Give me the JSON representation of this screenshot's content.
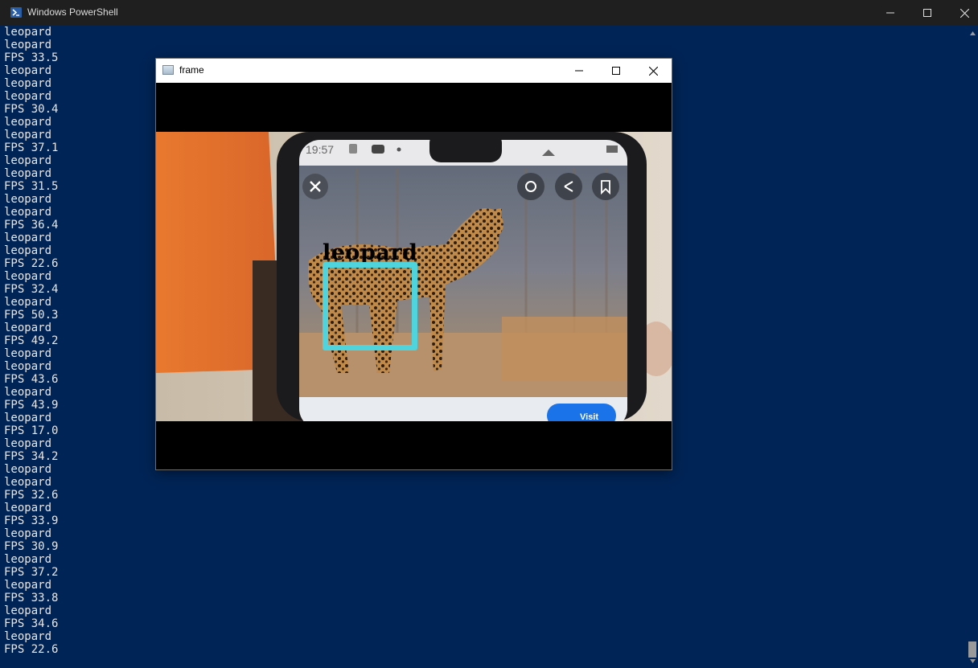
{
  "window": {
    "title": "Windows PowerShell",
    "icon": "powershell-icon",
    "controls": [
      "minimize-icon",
      "maximize-icon",
      "close-icon"
    ]
  },
  "console": {
    "lines": [
      "leopard",
      "leopard",
      "FPS 33.5",
      "leopard",
      "leopard",
      "leopard",
      "FPS 30.4",
      "leopard",
      "leopard",
      "FPS 37.1",
      "leopard",
      "leopard",
      "FPS 31.5",
      "leopard",
      "leopard",
      "FPS 36.4",
      "leopard",
      "leopard",
      "FPS 22.6",
      "leopard",
      "FPS 32.4",
      "leopard",
      "FPS 50.3",
      "leopard",
      "FPS 49.2",
      "leopard",
      "leopard",
      "FPS 43.6",
      "leopard",
      "FPS 43.9",
      "leopard",
      "FPS 17.0",
      "leopard",
      "FPS 34.2",
      "leopard",
      "leopard",
      "FPS 32.6",
      "leopard",
      "FPS 33.9",
      "leopard",
      "FPS 30.9",
      "leopard",
      "FPS 37.2",
      "leopard",
      "FPS 33.8",
      "leopard",
      "FPS 34.6",
      "leopard",
      "FPS 22.6"
    ]
  },
  "frame_window": {
    "title": "frame",
    "detection_label": "leopard",
    "phone_status_time": "19:57",
    "phone_button_text": "Visit",
    "box_color": "#4fd3dc"
  },
  "colors": {
    "console_background": "#012456",
    "console_text": "#e8e8e8",
    "titlebar": "#1f1f1f"
  }
}
